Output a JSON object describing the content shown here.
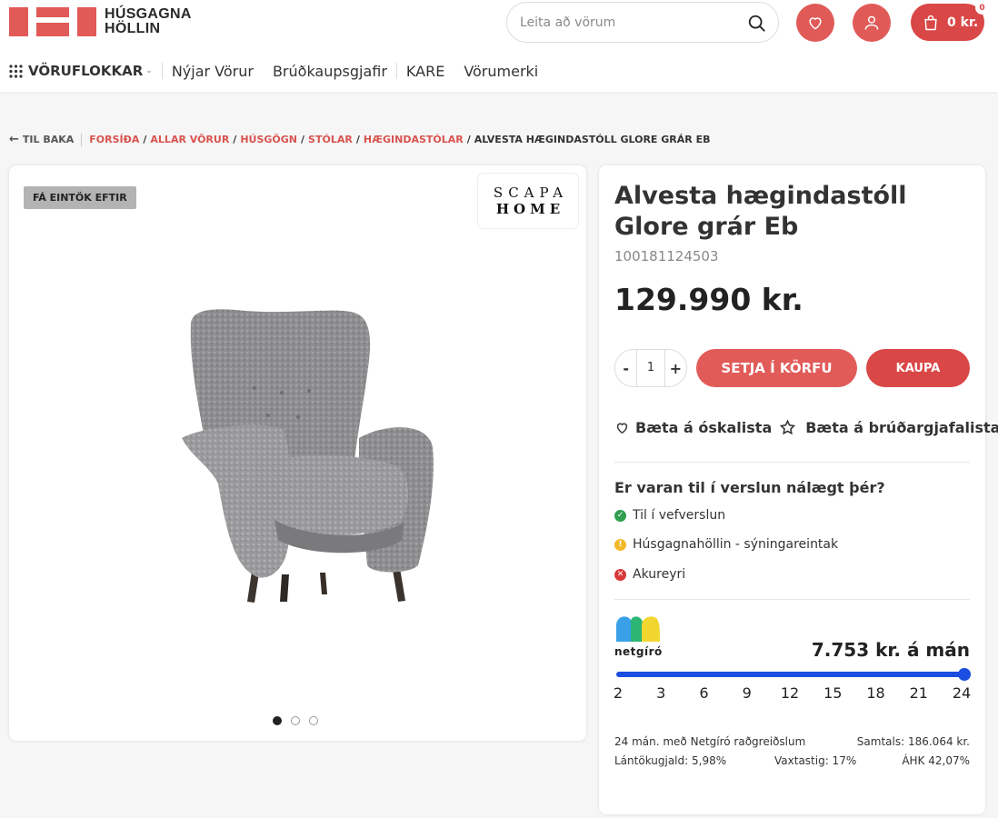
{
  "header": {
    "logo": {
      "line1": "HÚSGAGNA",
      "line2": "HÖLLIN",
      "color": "#e15a58"
    },
    "search": {
      "placeholder": "Leita að vörum",
      "icon": "search-icon"
    },
    "wishlist_icon": "heart-icon",
    "account_icon": "user-icon",
    "cart": {
      "icon": "shopping-bag-icon",
      "total": "0 kr.",
      "count": "0"
    }
  },
  "nav": {
    "categories_label": "VÖRUFLOKKAR",
    "items": [
      {
        "label": "Nýjar Vörur"
      },
      {
        "label": "Brúðkaupsgjafir"
      },
      {
        "label": "KARE"
      },
      {
        "label": "Vörumerki"
      }
    ]
  },
  "breadcrumb": {
    "back": "TIL BAKA",
    "links": [
      "FORSÍÐA",
      "ALLAR VÖRUR",
      "HÚSGÖGN",
      "STÓLAR",
      "HÆGINDASTÓLAR"
    ],
    "current": "ALVESTA HÆGINDASTÓLL GLORE GRÁR EB"
  },
  "gallery": {
    "badge": "FÁ EINTÖK EFTIR",
    "brand": {
      "line1": "SCAPA",
      "line2": "HOME"
    },
    "slide_count": 3,
    "active_slide": 1
  },
  "product": {
    "title": "Alvesta hægindastóll Glore grár Eb",
    "sku": "100181124503",
    "price": "129.990 kr.",
    "quantity": {
      "minus": "-",
      "value": "1",
      "plus": "+"
    },
    "add_to_cart": "SETJA Í KÖRFU",
    "buy": "KAUPA",
    "add_wishlist": "Bæta á óskalista",
    "add_wedding_list": "Bæta á brúðargjafalista",
    "accent": "#e15b59"
  },
  "availability": {
    "question": "Er varan til í verslun nálægt þér?",
    "stores": [
      {
        "name": "Til í vefverslun",
        "status": "in-stock",
        "color": "#2e9e4f",
        "icon": "check-circle-icon"
      },
      {
        "name": "Húsgagnahöllin - sýningareintak",
        "status": "display",
        "color": "#f2b928",
        "icon": "exclamation-circle-icon"
      },
      {
        "name": "Akureyri",
        "status": "out-of-stock",
        "color": "#d9393a",
        "icon": "x-circle-icon"
      }
    ]
  },
  "financing": {
    "logo_text": "netgíró",
    "monthly": "7.753 kr. á mán",
    "months_options": [
      "2",
      "3",
      "6",
      "9",
      "12",
      "15",
      "18",
      "21",
      "24"
    ],
    "selected_months": "24",
    "slider_fraction": 1.0,
    "slider_color": "#1a4de0",
    "summary": "24 mán. með Netgíró raðgreiðslum",
    "total": "Samtals: 186.064 kr.",
    "fee": "Lántökugjald: 5,98%",
    "interest": "Vaxtastig: 17%",
    "apr": "ÁHK 42,07%"
  }
}
